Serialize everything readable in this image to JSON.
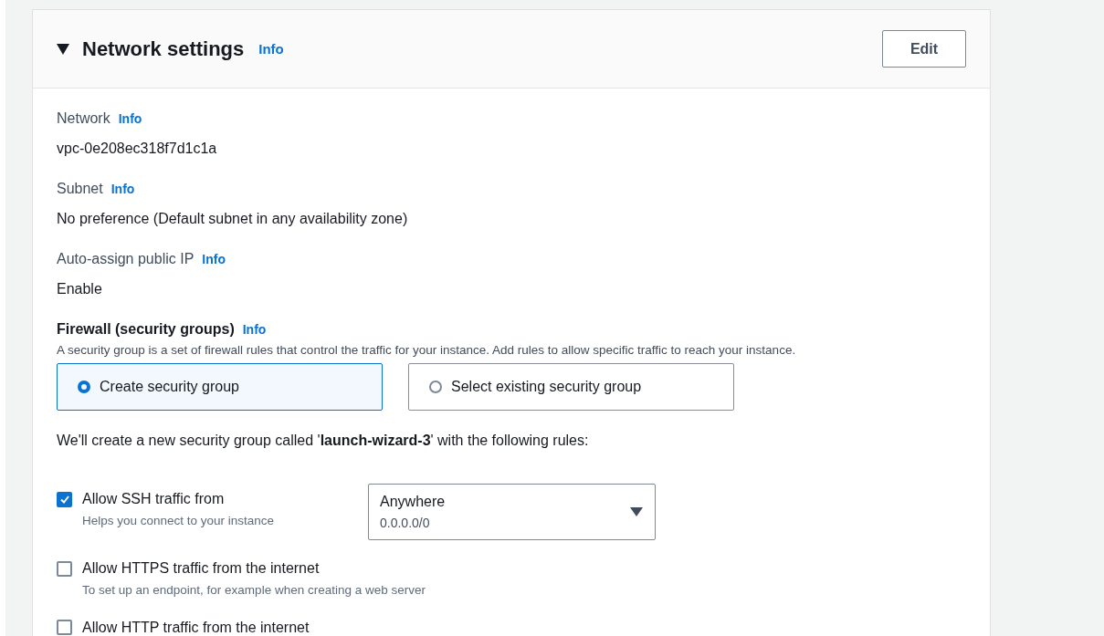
{
  "section": {
    "title": "Network settings",
    "info": "Info",
    "expanded": true,
    "edit_button": "Edit"
  },
  "fields": [
    {
      "label": "Network",
      "info": "Info",
      "value": "vpc-0e208ec318f7d1c1a"
    },
    {
      "label": "Subnet",
      "info": "Info",
      "value": "No preference (Default subnet in any availability zone)"
    },
    {
      "label": "Auto-assign public IP",
      "info": "Info",
      "value": "Enable"
    }
  ],
  "firewall": {
    "label": "Firewall (security groups)",
    "info": "Info",
    "description": "A security group is a set of firewall rules that control the traffic for your instance. Add rules to allow specific traffic to reach your instance.",
    "options": [
      {
        "label": "Create security group",
        "selected": true
      },
      {
        "label": "Select existing security group",
        "selected": false
      }
    ],
    "note": "We'll create a new security group called '**launch-wizard-3**' with the following rules:"
  },
  "rules": [
    {
      "label": "Allow SSH traffic from",
      "hint": "Helps you connect to your instance",
      "checked": true,
      "source": {
        "value": "Anywhere",
        "detail": "0.0.0.0/0"
      }
    },
    {
      "label": "Allow HTTPS traffic from the internet",
      "hint": "To set up an endpoint, for example when creating a web server",
      "checked": false
    },
    {
      "label": "Allow HTTP traffic from the internet",
      "checked": false
    }
  ]
}
